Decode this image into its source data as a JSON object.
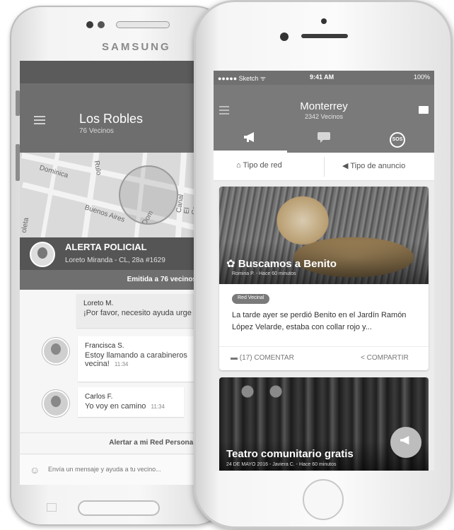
{
  "samsung": {
    "brand": "SAMSUNG",
    "header": {
      "title": "Los Robles",
      "subtitle": "76 Vecinos"
    },
    "tabs": [
      "megaphone-icon",
      "chat-icon"
    ],
    "map": {
      "labels": [
        "Dominica",
        "Rulo",
        "Canal El Carmen",
        "Buenos Aires",
        "Dom",
        "oleta"
      ]
    },
    "alert": {
      "title": "ALERTA POLICIAL",
      "subtitle": "Loreto Miranda - CL, 28a #1629",
      "emitted": "Emitida a 76 vecinos"
    },
    "messages": [
      {
        "sender": "Loreto M.",
        "text": "¡Por favor, necesito ayuda urge",
        "time": ""
      },
      {
        "sender": "Francisca S.",
        "text": "Estoy llamando a carabineros vecina!",
        "time": "11:34"
      },
      {
        "sender": "Carlos F.",
        "text": "Yo voy en camino",
        "time": "11:34"
      }
    ],
    "alert_network_label": "Alertar a mi Red Personal",
    "input_placeholder": "Envía un mensaje y ayuda a tu vecino..."
  },
  "iphone": {
    "status": {
      "carrier": "●●●●● Sketch ᯤ",
      "time": "9:41 AM",
      "battery": "100%"
    },
    "header": {
      "title": "Monterrey",
      "subtitle": "2342 Vecinos"
    },
    "tabs": {
      "sos": "SOS"
    },
    "filters": {
      "network": "Tipo de red",
      "announcement": "Tipo de anuncio"
    },
    "post": {
      "title": "Buscamos a Benito",
      "meta": "Romina P. - Hace 60 minutos",
      "badge": "Red Vecinal",
      "text": "La tarde ayer se perdió Benito en el Jardín Ramón López Velarde, estaba con collar rojo y...",
      "comment_label": "(17) COMENTAR",
      "share_label": "COMPARTIR"
    },
    "post2": {
      "title": "Teatro comunitario gratis",
      "meta": "24 DE MAYO 2016 - Javiera C. - Hace 60 minutos"
    }
  }
}
